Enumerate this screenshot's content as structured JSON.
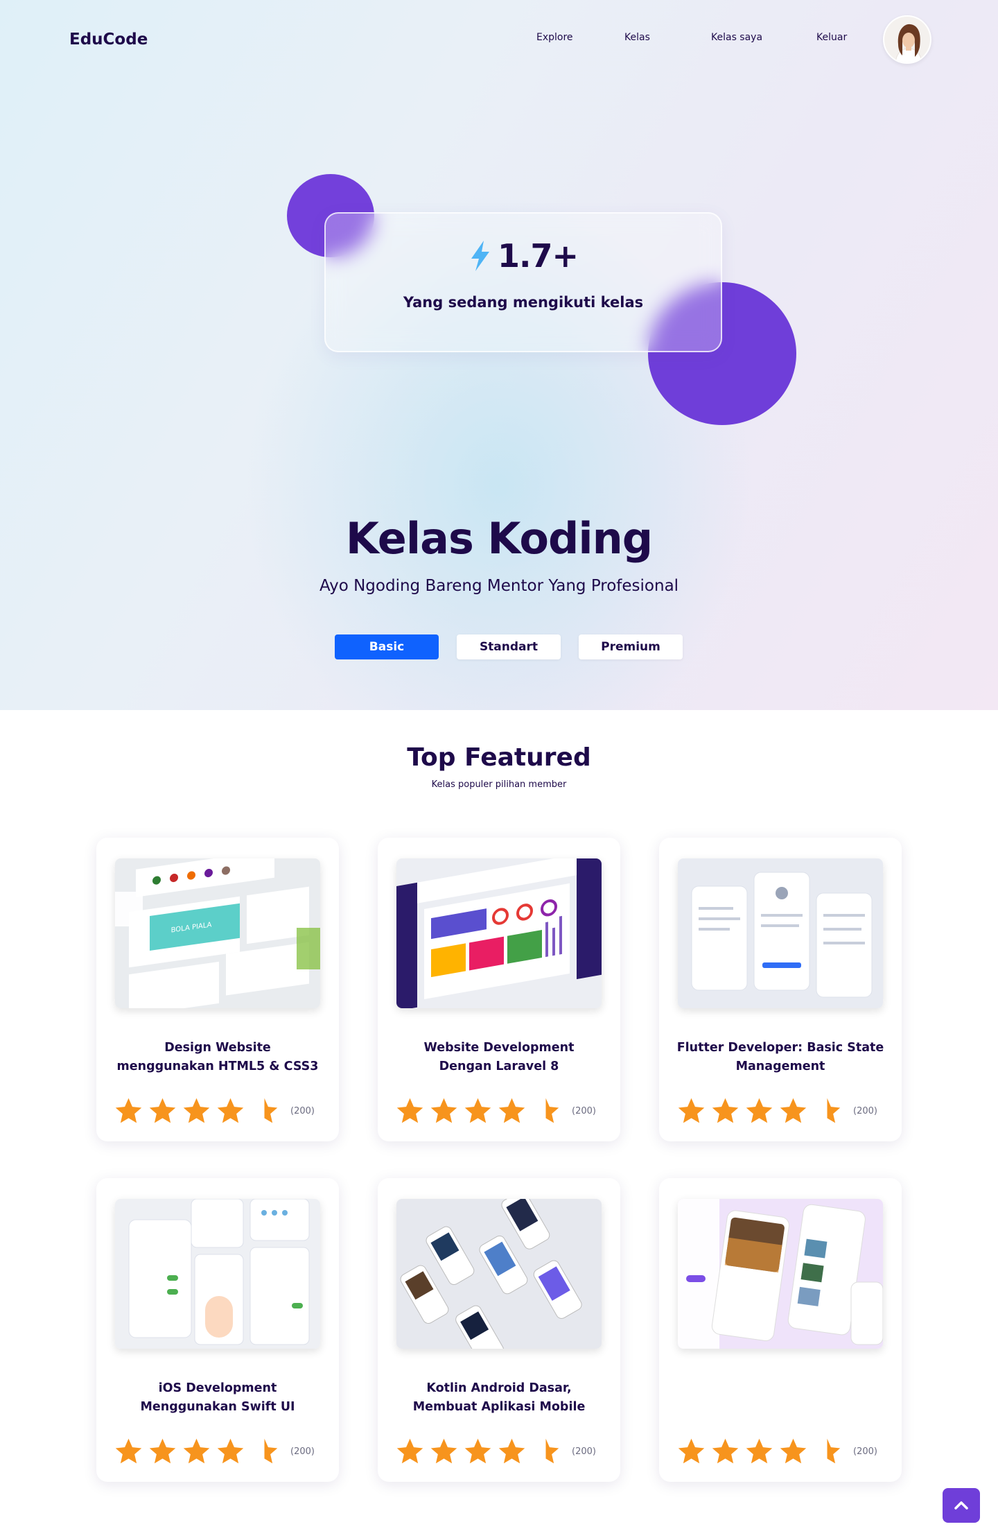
{
  "header": {
    "logo": "EduCode",
    "nav": [
      {
        "label": "Explore"
      },
      {
        "label": "Kelas"
      },
      {
        "label": "Kelas saya"
      },
      {
        "label": "Keluar"
      }
    ]
  },
  "hero": {
    "stat_value": "1.7+",
    "stat_label": "Yang sedang mengikuti kelas",
    "title": "Kelas Koding",
    "subtitle": "Ayo Ngoding Bareng Mentor Yang Profesional",
    "tiers": [
      {
        "label": "Basic",
        "active": true
      },
      {
        "label": "Standart",
        "active": false
      },
      {
        "label": "Premium",
        "active": false
      }
    ]
  },
  "featured": {
    "title": "Top Featured",
    "subtitle": "Kelas populer pilihan member",
    "cards": [
      {
        "title_line1": "Design Website",
        "title_line2": "menggunakan HTML5 & CSS3",
        "rating": 4.5,
        "count": "(200)"
      },
      {
        "title_line1": "Website Development",
        "title_line2": "Dengan Laravel 8",
        "rating": 4.5,
        "count": "(200)"
      },
      {
        "title_line1": "Flutter Developer: Basic State",
        "title_line2": "Management",
        "rating": 4.5,
        "count": "(200)"
      },
      {
        "title_line1": "iOS Development",
        "title_line2": "Menggunakan Swift UI",
        "rating": 4.5,
        "count": "(200)"
      },
      {
        "title_line1": "Kotlin Android Dasar,",
        "title_line2": "Membuat Aplikasi Mobile",
        "rating": 4.5,
        "count": "(200)"
      },
      {
        "title_line1": "",
        "title_line2": "",
        "rating": 4.5,
        "count": "(200)"
      }
    ]
  },
  "colors": {
    "primary_dark": "#1e0a4a",
    "accent_purple": "#6f3ed9",
    "accent_blue": "#0f62fe",
    "star": "#f7941d"
  },
  "icons": {
    "stat": "lightning-bolt-icon",
    "rating": "star-icon",
    "scroll": "chevron-up-icon"
  }
}
